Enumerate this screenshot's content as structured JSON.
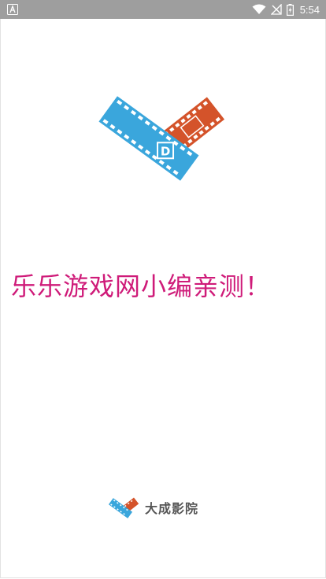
{
  "status_bar": {
    "time": "5:54",
    "left_icon": "a-notification-icon",
    "icons": [
      "wifi-icon",
      "signal-off-icon",
      "battery-charging-icon"
    ]
  },
  "splash": {
    "logo": "film-heart-logo",
    "logo_letter": "D",
    "promo_text": "乐乐游戏网小编亲测！",
    "promo_color": "#cf1b79",
    "brand_name": "大成影院"
  },
  "colors": {
    "logo_blue": "#3aa6dc",
    "logo_red": "#d4532a",
    "status_bar": "#9e9e9e"
  }
}
